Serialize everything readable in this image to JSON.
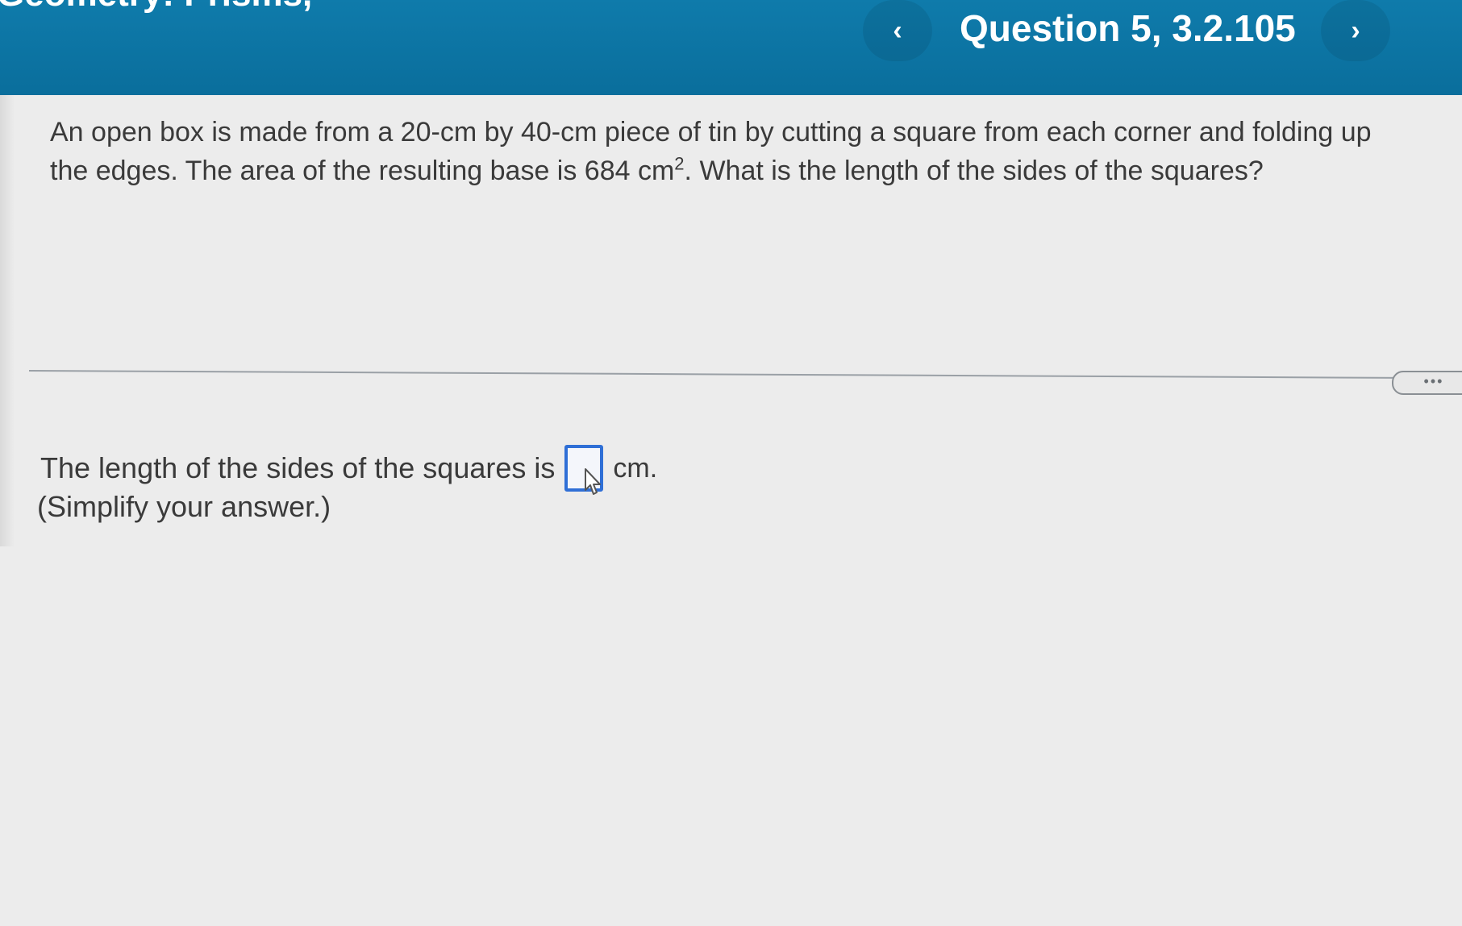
{
  "header": {
    "course_title": "Geometry: Prisms,",
    "question_label": "Question 5, 3.2.105",
    "prev_icon": "chevron-left-icon",
    "next_icon": "chevron-right-icon",
    "prev_glyph": "‹",
    "next_glyph": "›"
  },
  "question": {
    "text_before_sup": "An open box is made from a 20-cm by 40-cm piece of tin by cutting a square from each corner and folding up the edges. The area of the resulting base is 684 cm",
    "sup": "2",
    "text_after_sup": ". What is the length of the sides of the squares?"
  },
  "more_button": {
    "label": "•••"
  },
  "answer": {
    "prefix": "The length of the sides of the squares is",
    "value": "",
    "unit": "cm.",
    "hint": "(Simplify your answer.)"
  },
  "colors": {
    "topbar": "#0f7bab",
    "answer_box_border": "#2f6fd6"
  }
}
